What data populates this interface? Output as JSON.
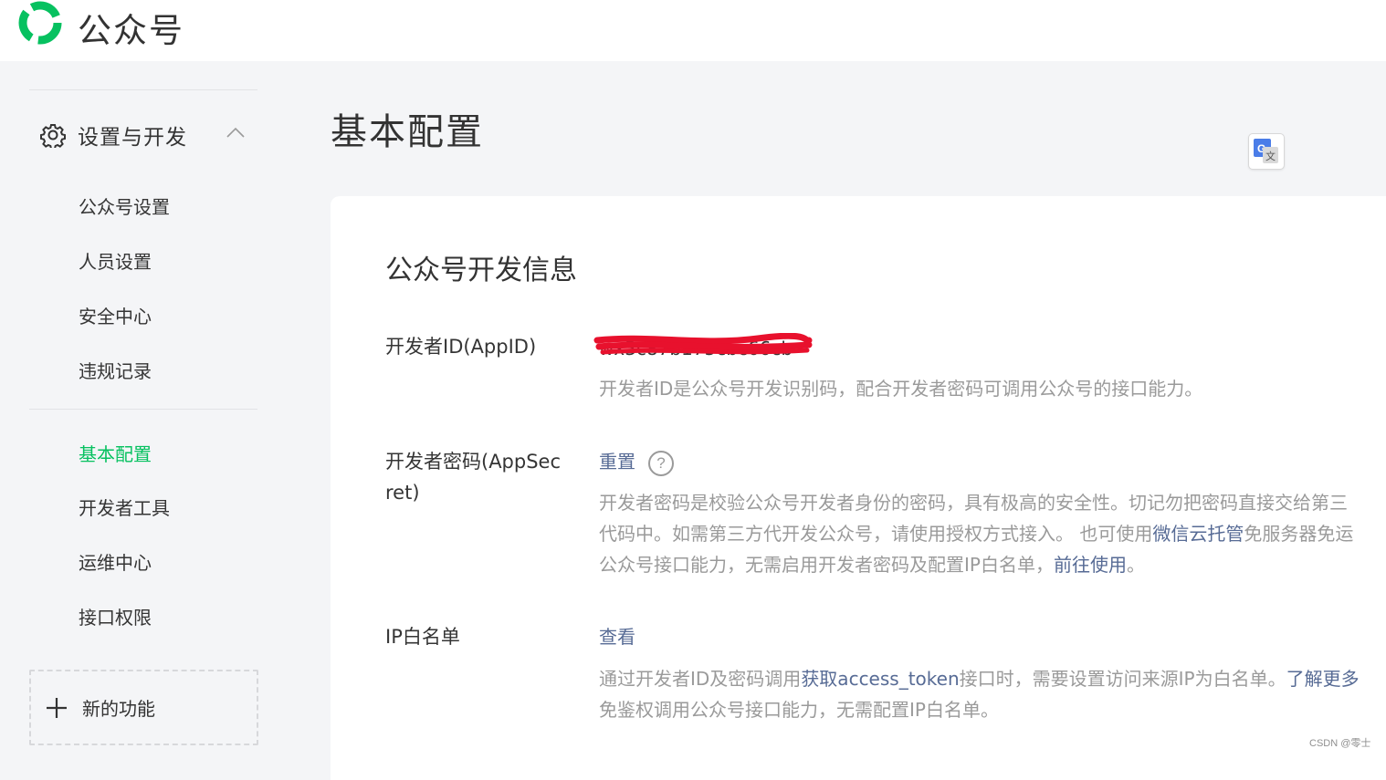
{
  "header": {
    "brand": "公众号"
  },
  "sidebar": {
    "section_title": "设置与开发",
    "items": [
      {
        "label": "公众号设置"
      },
      {
        "label": "人员设置"
      },
      {
        "label": "安全中心"
      },
      {
        "label": "违规记录"
      },
      {
        "label": "基本配置",
        "active": true
      },
      {
        "label": "开发者工具"
      },
      {
        "label": "运维中心"
      },
      {
        "label": "接口权限"
      }
    ],
    "new_feature_label": "新的功能"
  },
  "main": {
    "title": "基本配置",
    "card_title": "公众号开发信息",
    "appid": {
      "label": "开发者ID(AppID)",
      "value": "wx3c87b175cbc66cb",
      "desc": "开发者ID是公众号开发识别码，配合开发者密码可调用公众号的接口能力。"
    },
    "appsecret": {
      "label_line1": "开发者密码(AppSec",
      "label_line2": "ret)",
      "action": "重置",
      "help": "?",
      "desc_line1": "开发者密码是校验公众号开发者身份的密码，具有极高的安全性。切记勿把密码直接交给第三",
      "desc_line2_a": "代码中。如需第三方代开发公众号，请使用授权方式接入。 也可使用",
      "desc_line2_link": "微信云托管",
      "desc_line2_b": "免服务器免运",
      "desc_line3_a": "公众号接口能力，无需启用开发者密码及配置IP白名单，",
      "desc_line3_link": "前往使用",
      "desc_line3_b": "。"
    },
    "ip_whitelist": {
      "label": "IP白名单",
      "action": "查看",
      "desc_line1_a": "通过开发者ID及密码调用",
      "desc_line1_link": "获取access_token",
      "desc_line1_b": "接口时，需要设置访问来源IP为白名单。",
      "desc_line1_link2": "了解更多",
      "desc_line2": "免鉴权调用公众号接口能力，无需配置IP白名单。"
    }
  },
  "watermark": "CSDN @零士",
  "colors": {
    "brand_green": "#07c160",
    "link": "#576b95",
    "muted": "#9a9a9a",
    "redaction": "#e8112d"
  }
}
